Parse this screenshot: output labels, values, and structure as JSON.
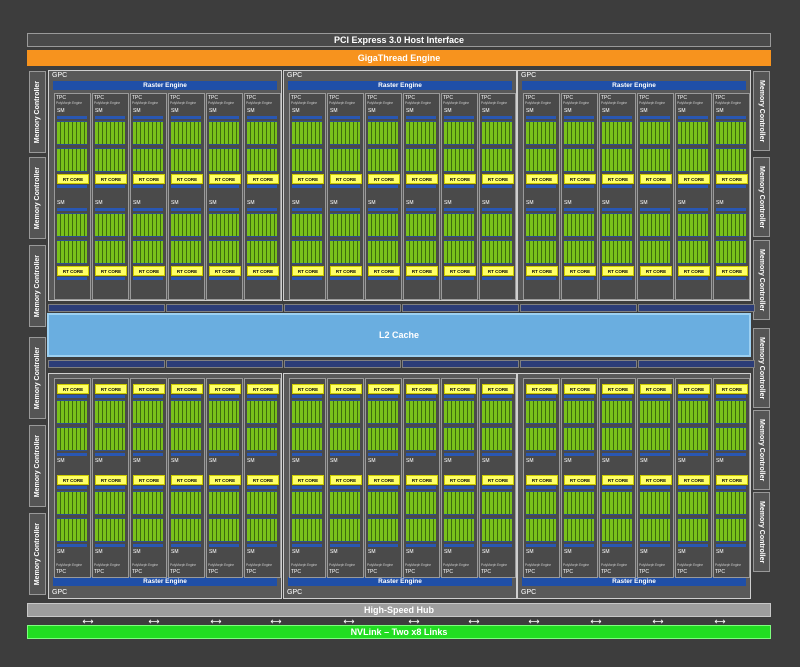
{
  "labels": {
    "pcie": "PCI Express 3.0 Host Interface",
    "gigathread": "GigaThread Engine",
    "l2": "L2 Cache",
    "hub": "High-Speed Hub",
    "nvlink": "NVLink – Two x8 Links",
    "memory_controller": "Memory Controller",
    "gpc": "GPC",
    "raster": "Raster Engine",
    "tpc": "TPC",
    "sm": "SM",
    "rt_core": "RT CORE",
    "polymorph": "PolyMorph Engine"
  },
  "counts": {
    "gpcs": 6,
    "tpcs_per_gpc": 6,
    "sms_per_tpc": 2,
    "memory_controllers": 12
  },
  "colors": {
    "background": "#3d3d3d",
    "gigathread": "#f7931e",
    "l2": "#6aaee0",
    "nvlink": "#22dd22",
    "hub": "#9e9e9e",
    "raster": "#1f4fa8",
    "rt_core": "#ffff66",
    "cuda_core": "#79c11b"
  }
}
